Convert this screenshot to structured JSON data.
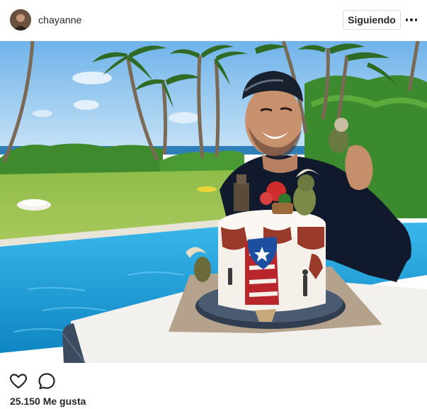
{
  "post": {
    "username": "chayanne",
    "follow_label": "Siguiendo",
    "more_icon": "ellipsis-icon",
    "likes_text": "25.150 Me gusta"
  },
  "actions": {
    "like_icon": "heart-icon",
    "comment_icon": "comment-icon"
  },
  "colors": {
    "text": "#262626",
    "border": "#dbdbdb",
    "sky": "#8fc6ef",
    "pool": "#1f9fd8",
    "flag_blue": "#1d4fa0",
    "flag_red": "#b8252a"
  }
}
